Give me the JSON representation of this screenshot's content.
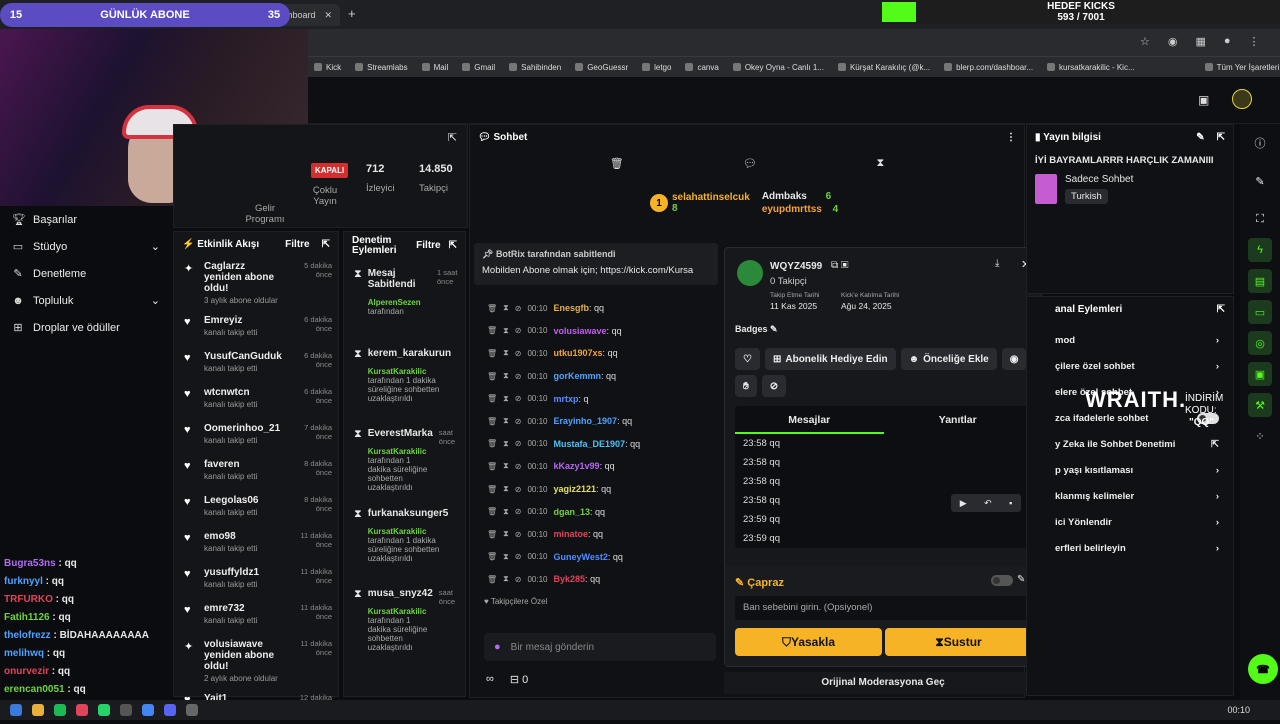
{
  "browser": {
    "tab_title": "Stream - Kick Dashboard",
    "bookmarks": [
      "Kick",
      "Streamlabs",
      "Mail",
      "Gmail",
      "Sahibinden",
      "GeoGuessr",
      "letgo",
      "canva",
      "Okey Oyna - Canlı 1...",
      "Kürşat Karakılıç (@k...",
      "blerp.com/dashboar...",
      "kursatkarakilic - Kic...",
      "Tüm Yer İşaretleri"
    ]
  },
  "overlay": {
    "left_num": "15",
    "title": "GÜNLÜK ABONE",
    "right_num": "35",
    "goal_title": "HEDEF KICKS",
    "goal_value": "593 / 7001",
    "goal_progress": 0.085
  },
  "sidebar": {
    "items": [
      {
        "label": "Başarılar",
        "icon": "trophy-icon"
      },
      {
        "label": "Stüdyo",
        "icon": "studio-icon"
      },
      {
        "label": "Denetleme",
        "icon": "wrench-icon"
      },
      {
        "label": "Topluluk",
        "icon": "community-icon"
      },
      {
        "label": "Droplar ve ödüller",
        "icon": "gift-icon"
      }
    ]
  },
  "stats": {
    "live_badge": "KAPALI",
    "viewers_value": "712",
    "viewers_label": "İzleyici",
    "followers_value": "14.850",
    "followers_label": "Takipçi",
    "chat_label": "Çoklu Yayın",
    "income_label": "Gelir Programı"
  },
  "event_feed": {
    "title": "Etkinlik Akışı",
    "filter": "Filtre",
    "items": [
      {
        "name": "Caglarzz yeniden abone oldu!",
        "sub": "3 aylık abone oldular",
        "time": "5 dakika önce",
        "icon": "sparkle-icon"
      },
      {
        "name": "Emreyiz",
        "sub": "kanalı takip etti",
        "time": "6 dakika önce",
        "icon": "heart-icon"
      },
      {
        "name": "YusufCanGuduk",
        "sub": "kanalı takip etti",
        "time": "6 dakika önce",
        "icon": "heart-icon"
      },
      {
        "name": "wtcnwtcn",
        "sub": "kanalı takip etti",
        "time": "6 dakika önce",
        "icon": "heart-icon"
      },
      {
        "name": "Oomerinhoo_21",
        "sub": "kanalı takip etti",
        "time": "7 dakika önce",
        "icon": "heart-icon"
      },
      {
        "name": "faveren",
        "sub": "kanalı takip etti",
        "time": "8 dakika önce",
        "icon": "heart-icon"
      },
      {
        "name": "Leegolas06",
        "sub": "kanalı takip etti",
        "time": "8 dakika önce",
        "icon": "heart-icon"
      },
      {
        "name": "emo98",
        "sub": "kanalı takip etti",
        "time": "11 dakika önce",
        "icon": "heart-icon"
      },
      {
        "name": "yusuffyldz1",
        "sub": "kanalı takip etti",
        "time": "11 dakika önce",
        "icon": "heart-icon"
      },
      {
        "name": "emre732",
        "sub": "kanalı takip etti",
        "time": "11 dakika önce",
        "icon": "heart-icon"
      },
      {
        "name": "volusiawave yeniden abone oldu!",
        "sub": "2 aylık abone oldular",
        "time": "11 dakika önce",
        "icon": "sparkle-icon"
      },
      {
        "name": "Yait1",
        "sub": "",
        "time": "12 dakika önce",
        "icon": "heart-icon"
      }
    ]
  },
  "mod_log": {
    "title": "Denetim Eylemleri",
    "filter": "Filtre",
    "items": [
      {
        "name": "Mesaj Sabitlendi",
        "by": "AlperenSezen",
        "sub": "tarafından",
        "time": "1 saat önce"
      },
      {
        "name": "kerem_karakurun",
        "by": "KursatKarakilic",
        "sub": "tarafından 1 dakika süreliğine sohbetten uzaklaştırıldı",
        "time": ""
      },
      {
        "name": "EverestMarka",
        "by": "KursatKarakilic",
        "sub": "tarafından 1 dakika süreliğine sohbetten uzaklaştırıldı",
        "time": "saat önce"
      },
      {
        "name": "furkanaksunger5",
        "by": "KursatKarakilic",
        "sub": "tarafından 1 dakika süreliğine sohbetten uzaklaştırıldı",
        "time": ""
      },
      {
        "name": "musa_snyz42",
        "by": "KursatKarakilic",
        "sub": "tarafından 1 dakika süreliğine sohbetten uzaklaştırıldı",
        "time": "saat önce"
      }
    ]
  },
  "chat": {
    "title": "Sohbet",
    "leaders": [
      {
        "name": "selahattinselcuk",
        "count": "8",
        "rank": "1"
      },
      {
        "name": "Admbaks",
        "count": "6"
      },
      {
        "name": "eyupdmrttss",
        "count": "4"
      }
    ],
    "pinned_by": "BotRix tarafından sabitlendi",
    "pinned_text": "Mobilden Abone olmak için; https://kick.com/Kursa",
    "messages": [
      {
        "time": "00:10",
        "user": "Nativez2",
        "text": "qq",
        "color": "#6fd33f"
      },
      {
        "time": "00:10",
        "user": "Enesgfb",
        "text": "qq",
        "color": "#e6b04a"
      },
      {
        "time": "00:10",
        "user": "volusiawave",
        "text": "qq",
        "color": "#c35cf2"
      },
      {
        "time": "00:10",
        "user": "utku1907xs",
        "text": "qq",
        "color": "#f2a33a"
      },
      {
        "time": "00:10",
        "user": "gorKemmn",
        "text": "qq",
        "color": "#4fa3ff"
      },
      {
        "time": "00:10",
        "user": "mrtxp",
        "text": "q",
        "color": "#5b8cff"
      },
      {
        "time": "00:10",
        "user": "Erayinho_1907",
        "text": "qq",
        "color": "#4fa3ff"
      },
      {
        "time": "00:10",
        "user": "Mustafa_DE1907",
        "text": "qq",
        "color": "#4fc3f7"
      },
      {
        "time": "00:10",
        "user": "kKazy1v99",
        "text": "qq",
        "color": "#b666f2"
      },
      {
        "time": "00:10",
        "user": "yagiz2121",
        "text": "qq",
        "color": "#e6e05a"
      },
      {
        "time": "00:10",
        "user": "dgan_13",
        "text": "qq",
        "color": "#6fd33f"
      },
      {
        "time": "00:10",
        "user": "minatoe",
        "text": "qq",
        "color": "#e0445a"
      },
      {
        "time": "00:10",
        "user": "GuneyWest2",
        "text": "qq",
        "color": "#4f8cff"
      },
      {
        "time": "00:10",
        "user": "Byk285",
        "text": "qq",
        "color": "#e0445a"
      }
    ],
    "followers_only": "Takipçilere Özel",
    "input_placeholder": "Bir mesaj gönderin",
    "points": "0"
  },
  "user_card": {
    "username": "WQYZ4599",
    "followers": "0 Takipçi",
    "follow_date_label": "Takip Etme Tarihi",
    "follow_date": "11 Kas 2025",
    "join_label": "Kick'e Katılma Tarihi",
    "join_date": "Ağu 24, 2025",
    "badges_label": "Badges",
    "gift_sub": "Abonelik Hediye Edin",
    "priority": "Önceliğe Ekle",
    "tab_messages": "Mesajlar",
    "tab_replies": "Yanıtlar",
    "history": [
      "23:58 qq",
      "23:58 qq",
      "23:58 qq",
      "23:58 qq",
      "23:59 qq",
      "23:59 qq"
    ],
    "section": "Çapraz",
    "ban_placeholder": "Ban sebebini girin. (Opsiyonel)",
    "ban_button": "Yasakla",
    "timeout_button": "Sustur",
    "original_mod": "Orijinal Moderasyona Geç"
  },
  "stream_info": {
    "title": "Yayın bilgisi",
    "stream_title": "İYİ BAYRAMLARRR HARÇLIK ZAMANIII",
    "category": "Sadece Sohbet",
    "language": "Turkish"
  },
  "channel_actions": {
    "title": "anal Eylemleri",
    "items": [
      {
        "label": "mod",
        "sub": "a"
      },
      {
        "label": "çilere özel sohbet",
        "sub": ""
      },
      {
        "label": "elere özel sohbet",
        "sub": ""
      },
      {
        "label": "zca ifadelerle sohbet",
        "sub": ""
      },
      {
        "label": "y Zeka ile Sohbet Denetimi",
        "sub": ""
      },
      {
        "label": "p yaşı kısıtlaması",
        "sub": ""
      },
      {
        "label": "klanmış kelimeler",
        "sub": ""
      },
      {
        "label": "ici Yönlendir",
        "sub": ""
      },
      {
        "label": "erfleri belirleyin",
        "sub": ""
      }
    ],
    "wraith": "WRAITH.",
    "code_label": "İNDİRİM KODU:",
    "code_value": "\"QQ\""
  },
  "left_chat": [
    {
      "user": "Bugra53ns",
      "text": "qq",
      "color": "#b26cf2"
    },
    {
      "user": "furknyyl",
      "text": "qq",
      "color": "#4fa3ff"
    },
    {
      "user": "TRFURKO",
      "text": "qq",
      "color": "#e0445a"
    },
    {
      "user": "Fatih1126",
      "text": "qq",
      "color": "#6fd33f"
    },
    {
      "user": "thelofrezz",
      "text": "BİDAHAAAAAAAA",
      "color": "#4fa3ff"
    },
    {
      "user": "melihwq",
      "text": "qq",
      "color": "#4fa3ff"
    },
    {
      "user": "onurvezir",
      "text": "qq",
      "color": "#e0445a"
    },
    {
      "user": "erencan0051",
      "text": "qq",
      "color": "#6fd33f"
    }
  ],
  "clock": "00:10"
}
